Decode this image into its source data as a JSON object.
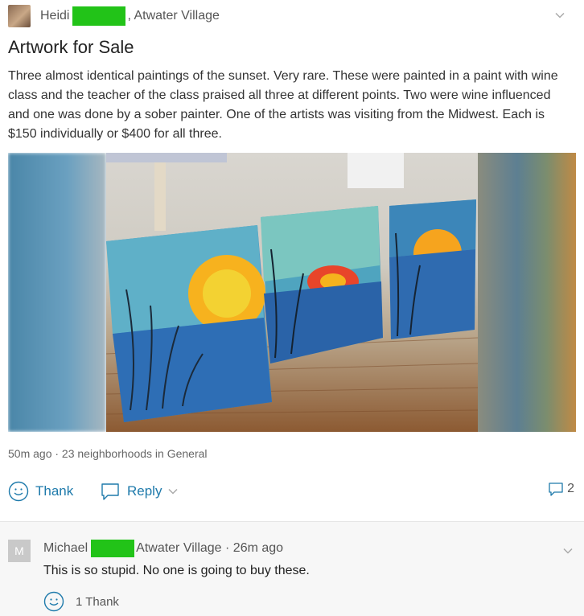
{
  "post": {
    "author": "Heidi",
    "location": ", Atwater Village",
    "title": "Artwork for Sale",
    "body": "Three almost identical paintings of the sunset. Very rare. These were painted in a paint with wine class and the teacher of the class praised all three at different points. Two were wine influenced and one was done by a sober painter. One of the artists was visiting from the Midwest. Each is $150 individually or $400 for all three.",
    "meta": "50m ago · 23 neighborhoods in General",
    "actions": {
      "thank_label": "Thank",
      "reply_label": "Reply",
      "reply_count": "2"
    }
  },
  "comment": {
    "avatar_initial": "M",
    "author": "Michael",
    "location": "Atwater Village · 26m ago",
    "text": "This is so stupid. No one is going to buy these.",
    "thank_label": "1 Thank"
  },
  "colors": {
    "redaction": "#22c318",
    "link": "#1e7aab"
  }
}
